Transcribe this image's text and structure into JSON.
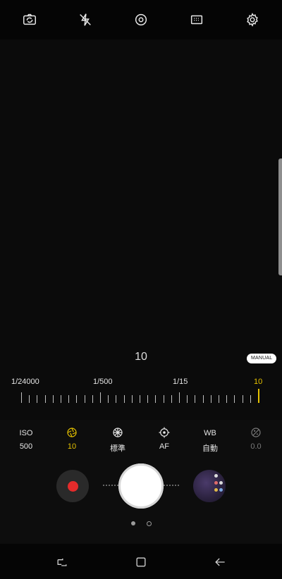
{
  "top_bar": {
    "icons": [
      "switch-camera-icon",
      "flash-off-icon",
      "eye-icon",
      "aspect-ratio-icon",
      "settings-gear-icon"
    ]
  },
  "mode_badge": "MANUAL",
  "readout": "10",
  "shutter_scale": {
    "labels": [
      "1/24000",
      "1/500",
      "1/15",
      "10"
    ],
    "active_color": "#e5c100"
  },
  "settings": [
    {
      "top": "ISO",
      "bottom": "500",
      "icon": null
    },
    {
      "top": "",
      "bottom": "10",
      "icon": "aperture-icon",
      "active": true
    },
    {
      "top": "",
      "bottom": "標準",
      "icon": "color-tone-icon"
    },
    {
      "top": "",
      "bottom": "AF",
      "icon": "focus-icon"
    },
    {
      "top": "WB",
      "bottom": "自動",
      "icon": null
    },
    {
      "top": "",
      "bottom": "0.0",
      "icon": "exposure-icon",
      "disabled": true
    }
  ],
  "colors": {
    "accent_yellow": "#e5c100",
    "record_red": "#e42b2b"
  }
}
